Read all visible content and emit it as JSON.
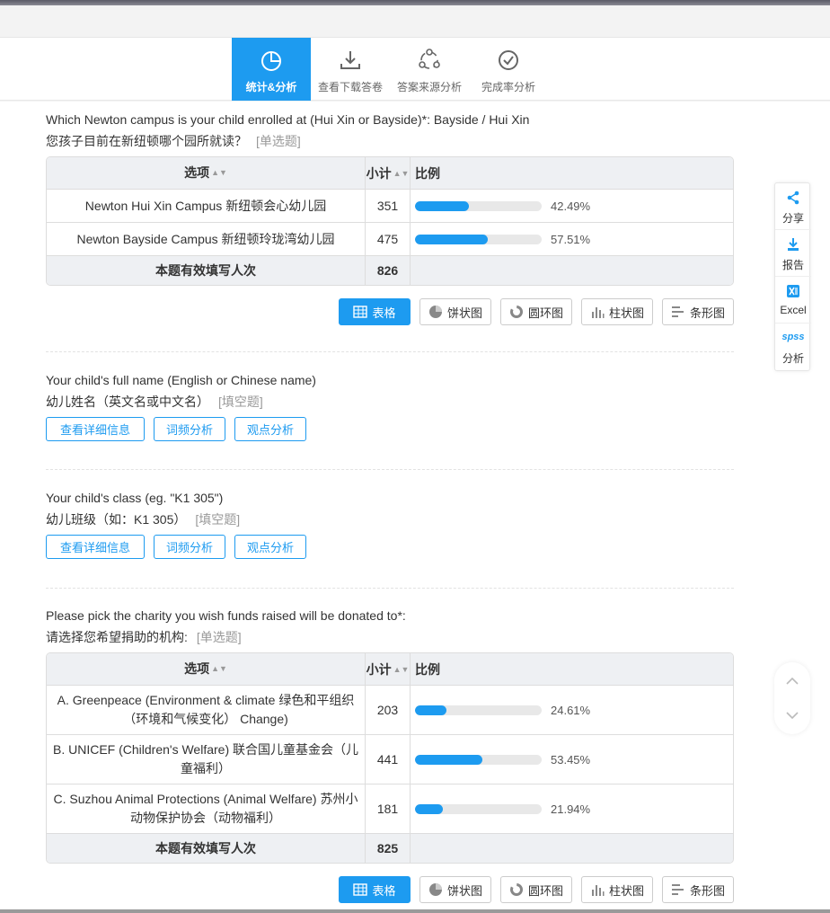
{
  "nav": {
    "tabs": [
      {
        "label": "统计&分析",
        "icon": "pie-chart-icon",
        "active": true
      },
      {
        "label": "查看下载答卷",
        "icon": "download-icon",
        "active": false
      },
      {
        "label": "答案来源分析",
        "icon": "share-nodes-icon",
        "active": false
      },
      {
        "label": "完成率分析",
        "icon": "check-circle-icon",
        "active": false
      }
    ]
  },
  "accent_color": "#1d9bf0",
  "table_header": {
    "option": "选项",
    "count": "小计",
    "ratio": "比例"
  },
  "chart_buttons": [
    "表格",
    "饼状图",
    "圆环图",
    "柱状图",
    "条形图"
  ],
  "action_buttons": [
    "查看详细信息",
    "词频分析",
    "观点分析"
  ],
  "q1": {
    "title": "Which Newton campus is your child enrolled at (Hui Xin or Bayside)*: Bayside / Hui Xin",
    "subtitle": "您孩子目前在新纽顿哪个园所就读？",
    "type": "[单选题]",
    "rows": [
      {
        "option": "Newton Hui Xin Campus 新纽顿会心幼儿园",
        "count": "351",
        "percent": "42.49%",
        "fraction": 0.4249
      },
      {
        "option": "Newton Bayside Campus 新纽顿玲珑湾幼儿园",
        "count": "475",
        "percent": "57.51%",
        "fraction": 0.5751
      }
    ],
    "total_label": "本题有效填写人次",
    "total": "826"
  },
  "q2": {
    "title": "Your child's full name (English or Chinese name)",
    "subtitle": "幼儿姓名（英文名或中文名）",
    "type": "[填空题]"
  },
  "q3": {
    "title": "Your child's class (eg. \"K1 305\")",
    "subtitle": "幼儿班级（如：K1 305）",
    "type": "[填空题]"
  },
  "q4": {
    "title": "Please pick the charity you wish funds raised will be donated to*:",
    "subtitle": "请选择您希望捐助的机构:",
    "type": "[单选题]",
    "rows": [
      {
        "option": "A. Greenpeace (Environment & climate 绿色和平组织（环境和气候变化） Change)",
        "count": "203",
        "percent": "24.61%",
        "fraction": 0.2461
      },
      {
        "option": "B. UNICEF (Children's Welfare) 联合国儿童基金会（儿童福利）",
        "count": "441",
        "percent": "53.45%",
        "fraction": 0.5345
      },
      {
        "option": "C. Suzhou Animal Protections (Animal Welfare) 苏州小动物保护协会（动物福利）",
        "count": "181",
        "percent": "21.94%",
        "fraction": 0.2194
      }
    ],
    "total_label": "本题有效填写人次",
    "total": "825"
  },
  "side_panel": [
    {
      "label": "分享",
      "icon": "share-icon"
    },
    {
      "label": "报告",
      "icon": "download-report-icon"
    },
    {
      "label": "Excel",
      "icon": "excel-icon"
    },
    {
      "label": "分析",
      "icon": "spss-icon",
      "badge": "spss"
    }
  ]
}
